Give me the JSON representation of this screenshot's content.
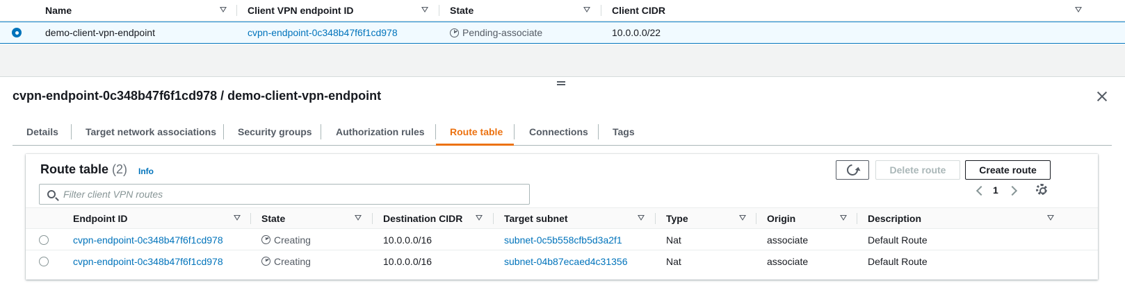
{
  "top_table": {
    "headers": [
      "Name",
      "Client VPN endpoint ID",
      "State",
      "Client CIDR"
    ],
    "row": {
      "name": "demo-client-vpn-endpoint",
      "endpoint_id": "cvpn-endpoint-0c348b47f6f1cd978",
      "state": "Pending-associate",
      "cidr": "10.0.0.0/22"
    }
  },
  "panel": {
    "title": "cvpn-endpoint-0c348b47f6f1cd978 / demo-client-vpn-endpoint",
    "tabs": [
      "Details",
      "Target network associations",
      "Security groups",
      "Authorization rules",
      "Route table",
      "Connections",
      "Tags"
    ],
    "active_tab": "Route table"
  },
  "route_table": {
    "title": "Route table",
    "count": "(2)",
    "info": "Info",
    "delete_label": "Delete route",
    "create_label": "Create route",
    "filter_placeholder": "Filter client VPN routes",
    "page": "1",
    "headers": [
      "Endpoint ID",
      "State",
      "Destination CIDR",
      "Target subnet",
      "Type",
      "Origin",
      "Description"
    ],
    "rows": [
      {
        "endpoint_id": "cvpn-endpoint-0c348b47f6f1cd978",
        "state": "Creating",
        "destination": "10.0.0.0/16",
        "subnet": "subnet-0c5b558cfb5d3a2f1",
        "type": "Nat",
        "origin": "associate",
        "description": "Default Route"
      },
      {
        "endpoint_id": "cvpn-endpoint-0c348b47f6f1cd978",
        "state": "Creating",
        "destination": "10.0.0.0/16",
        "subnet": "subnet-04b87ecaed4c31356",
        "type": "Nat",
        "origin": "associate",
        "description": "Default Route"
      }
    ]
  },
  "icons": [
    "radio-selected-icon",
    "clock-icon",
    "close-icon",
    "refresh-icon",
    "search-icon",
    "chevron-left-icon",
    "chevron-right-icon",
    "gear-icon",
    "sort-icon"
  ],
  "colors": {
    "accent": "#ec7211",
    "link": "#0073bb",
    "selected_row_bg": "#f1faff"
  }
}
